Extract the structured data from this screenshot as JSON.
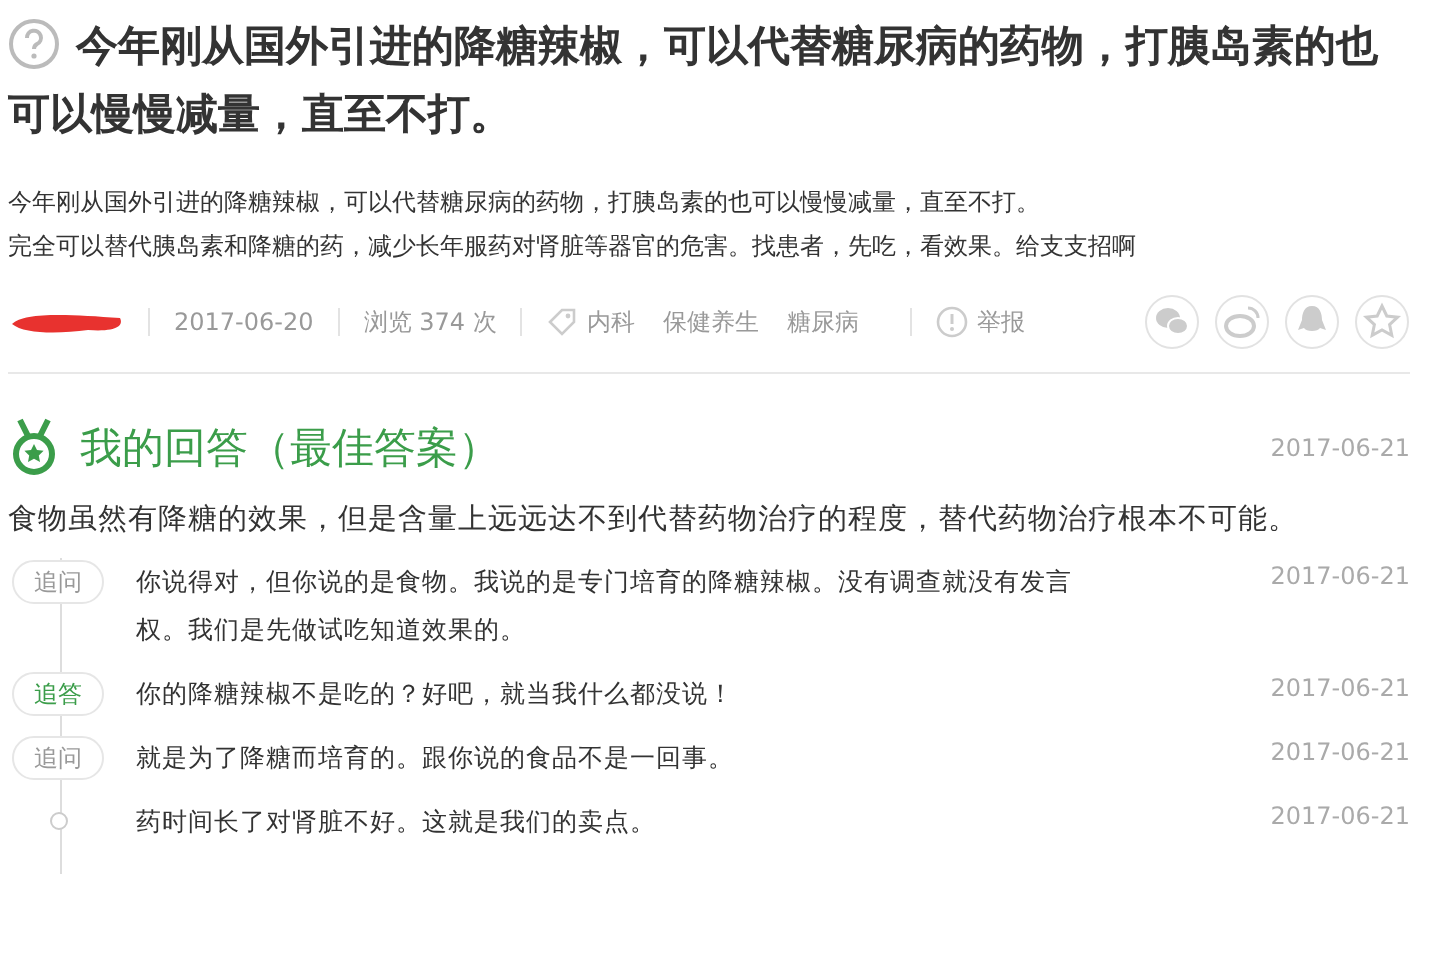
{
  "question": {
    "title": "今年刚从国外引进的降糖辣椒，可以代替糖尿病的药物，打胰岛素的也可以慢慢减量，直至不打。",
    "description": [
      "今年刚从国外引进的降糖辣椒，可以代替糖尿病的药物，打胰岛素的也可以慢慢减量，直至不打。",
      "完全可以替代胰岛素和降糖的药，减少长年服药对肾脏等器官的危害。找患者，先吃，看效果。给支支招啊"
    ],
    "meta": {
      "date": "2017-06-20",
      "views": "浏览 374 次",
      "tags": [
        "内科",
        "保健养生",
        "糖尿病"
      ],
      "report": "举报"
    }
  },
  "answer": {
    "heading": "我的回答（最佳答案）",
    "date": "2017-06-21",
    "text": "食物虽然有降糖的效果，但是含量上远远达不到代替药物治疗的程度，替代药物治疗根本不可能。",
    "followups": [
      {
        "kind": "ask",
        "label": "追问",
        "text": "你说得对，但你说的是食物。我说的是专门培育的降糖辣椒。没有调查就没有发言权。我们是先做试吃知道效果的。",
        "date": "2017-06-21"
      },
      {
        "kind": "reply",
        "label": "追答",
        "text": "你的降糖辣椒不是吃的？好吧，就当我什么都没说！",
        "date": "2017-06-21"
      },
      {
        "kind": "ask",
        "label": "追问",
        "text": "就是为了降糖而培育的。跟你说的食品不是一回事。",
        "date": "2017-06-21"
      },
      {
        "kind": "continued",
        "text": "药时间长了对肾脏不好。这就是我们的卖点。",
        "date": "2017-06-21"
      }
    ]
  }
}
